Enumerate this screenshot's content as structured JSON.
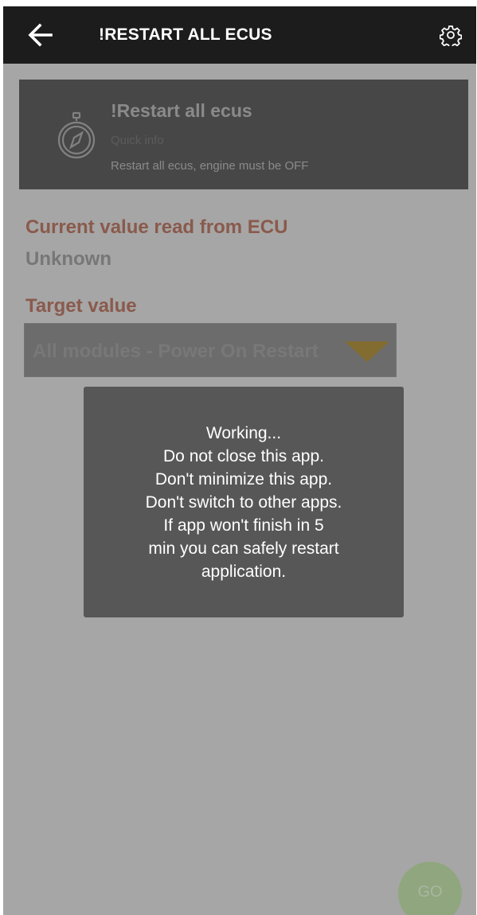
{
  "header": {
    "title": "!RESTART ALL ECUS",
    "back_icon": "arrow-left-icon",
    "settings_icon": "gear-icon"
  },
  "info_card": {
    "icon": "compass-icon",
    "title": "!Restart all ecus",
    "subtitle": "Quick info",
    "description": "Restart all ecus, engine must be OFF"
  },
  "current": {
    "label": "Current value read from ECU",
    "value": "Unknown"
  },
  "target": {
    "label": "Target value",
    "selected": "All modules - Power On Restart",
    "dropdown_icon": "triangle-down-icon"
  },
  "dialog": {
    "lines": [
      "Working...",
      "Do not close this app.",
      "Don't minimize this app.",
      "Don't switch to other apps.",
      "If app won't finish in 5",
      "min you can safely restart",
      "application."
    ]
  },
  "action": {
    "go_label": "GO"
  },
  "colors": {
    "topbar": "#1c1c1c",
    "card": "#6e6e6e",
    "accent_label": "#d48b76",
    "dropdown_arrow": "#c9a64b",
    "dialog": "#575757",
    "go_button": "#8fa67f"
  }
}
